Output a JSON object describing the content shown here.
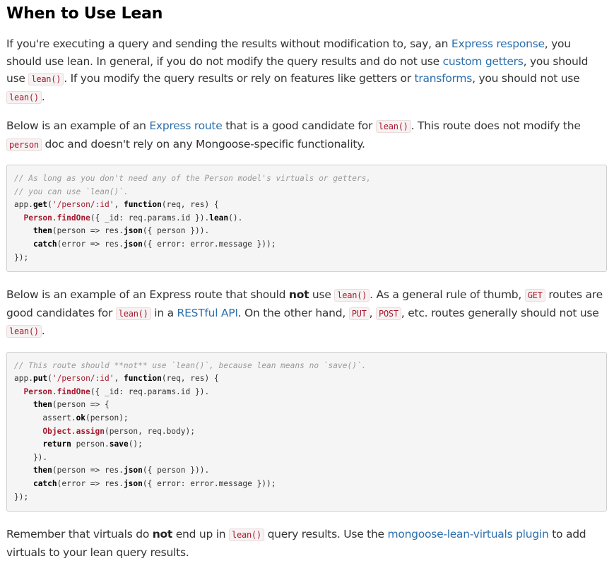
{
  "heading": "When to Use Lean",
  "p1": {
    "t1": "If you're executing a query and sending the results without modification to, say, an ",
    "link1": "Express response",
    "t2": ", you should use lean. In general, if you do not modify the query results and do not use ",
    "link2": "custom getters",
    "t3": ", you should use ",
    "code1": "lean()",
    "t4": ". If you modify the query results or rely on features like getters or ",
    "link3": "transforms",
    "t5": ", you should not use ",
    "code2": "lean()",
    "t6": "."
  },
  "p2": {
    "t1": "Below is an example of an ",
    "link1": "Express route",
    "t2": " that is a good candidate for ",
    "code1": "lean()",
    "t3": ". This route does not modify the ",
    "code2": "person",
    "t4": " doc and doesn't rely on any Mongoose-specific functionality."
  },
  "code1": {
    "l1": "// As long as you don't need any of the Person model's virtuals or getters,",
    "l2": "// you can use `lean()`.",
    "l3a": "app.",
    "l3b": "get",
    "l3c": "(",
    "l3d": "'/person/:id'",
    "l3e": ", ",
    "l3f": "function",
    "l3g": "(req, res) {",
    "l4a": "  ",
    "l4b": "Person",
    "l4c": ".",
    "l4d": "findOne",
    "l4e": "({ _id: req.params.id }).",
    "l4f": "lean",
    "l4g": "().",
    "l5a": "    ",
    "l5b": "then",
    "l5c": "(person => res.",
    "l5d": "json",
    "l5e": "({ person })).",
    "l6a": "    ",
    "l6b": "catch",
    "l6c": "(error => res.",
    "l6d": "json",
    "l6e": "({ error: error.message }));",
    "l7": "});"
  },
  "p3": {
    "t1": "Below is an example of an Express route that should ",
    "bold1": "not",
    "t2": " use ",
    "code1": "lean()",
    "t3": ". As a general rule of thumb, ",
    "code2": "GET",
    "t4": " routes are good candidates for ",
    "code3": "lean()",
    "t5": " in a ",
    "link1": "RESTful API",
    "t6": ". On the other hand, ",
    "code4": "PUT",
    "t7": ", ",
    "code5": "POST",
    "t8": ", etc. routes generally should not use ",
    "code6": "lean()",
    "t9": "."
  },
  "code2": {
    "l1": "// This route should **not** use `lean()`, because lean means no `save()`.",
    "l2a": "app.",
    "l2b": "put",
    "l2c": "(",
    "l2d": "'/person/:id'",
    "l2e": ", ",
    "l2f": "function",
    "l2g": "(req, res) {",
    "l3a": "  ",
    "l3b": "Person",
    "l3c": ".",
    "l3d": "findOne",
    "l3e": "({ _id: req.params.id }).",
    "l4a": "    ",
    "l4b": "then",
    "l4c": "(person => {",
    "l5a": "      assert.",
    "l5b": "ok",
    "l5c": "(person);",
    "l6a": "      ",
    "l6b": "Object",
    "l6c": ".",
    "l6d": "assign",
    "l6e": "(person, req.body);",
    "l7a": "      ",
    "l7b": "return",
    "l7c": " person.",
    "l7d": "save",
    "l7e": "();",
    "l8": "    }).",
    "l9a": "    ",
    "l9b": "then",
    "l9c": "(person => res.",
    "l9d": "json",
    "l9e": "({ person })).",
    "l10a": "    ",
    "l10b": "catch",
    "l10c": "(error => res.",
    "l10d": "json",
    "l10e": "({ error: error.message }));",
    "l11": "});"
  },
  "p4": {
    "t1": "Remember that virtuals do ",
    "bold1": "not",
    "t2": " end up in ",
    "code1": "lean()",
    "t3": " query results. Use the ",
    "link1": "mongoose-lean-virtuals plugin",
    "t4": " to add virtuals to your lean query results."
  }
}
